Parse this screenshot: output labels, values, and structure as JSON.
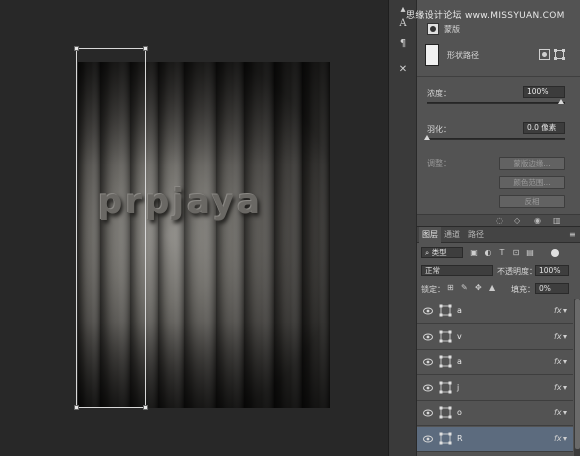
{
  "watermark": "思缘设计论坛 www.MISSYUAN.COM",
  "canvas": {
    "art_text": "prpjaya"
  },
  "icon_strip": {
    "icons": [
      "tool-icon-top",
      "text-tool-icon",
      "paragraph-icon",
      "tools-icon"
    ]
  },
  "properties": {
    "header_icon": "mask-icon",
    "header_title": "蒙版",
    "shape_label": "形状路径",
    "density_label": "浓度：",
    "density_value": "100%",
    "density_level": 1.0,
    "feather_label": "羽化：",
    "feather_value": "0.0 像素",
    "feather_level": 0.0,
    "adjust_label": "调整：",
    "btn_mask_edge": "蒙版边缘...",
    "btn_color_range": "颜色范围...",
    "btn_invert": "反相"
  },
  "layers_panel": {
    "tabs": [
      "图层",
      "通道",
      "路径"
    ],
    "active_tab": "图层",
    "filter_label": "类型",
    "blend_mode": "正常",
    "opacity_label": "不透明度：",
    "opacity_value": "100%",
    "lock_label": "锁定：",
    "fill_label": "填充：",
    "fill_value": "0%",
    "layers": [
      {
        "name": "a",
        "fx": "fx",
        "selected": false
      },
      {
        "name": "v",
        "fx": "fx",
        "selected": false
      },
      {
        "name": "a",
        "fx": "fx",
        "selected": false
      },
      {
        "name": "j",
        "fx": "fx",
        "selected": false
      },
      {
        "name": "o",
        "fx": "fx",
        "selected": false
      },
      {
        "name": "R",
        "fx": "fx",
        "selected": true
      }
    ]
  },
  "colors": {
    "canvas_bg": "#282828",
    "panel_bg": "#535353",
    "selected_layer": "#5c6b7e"
  }
}
